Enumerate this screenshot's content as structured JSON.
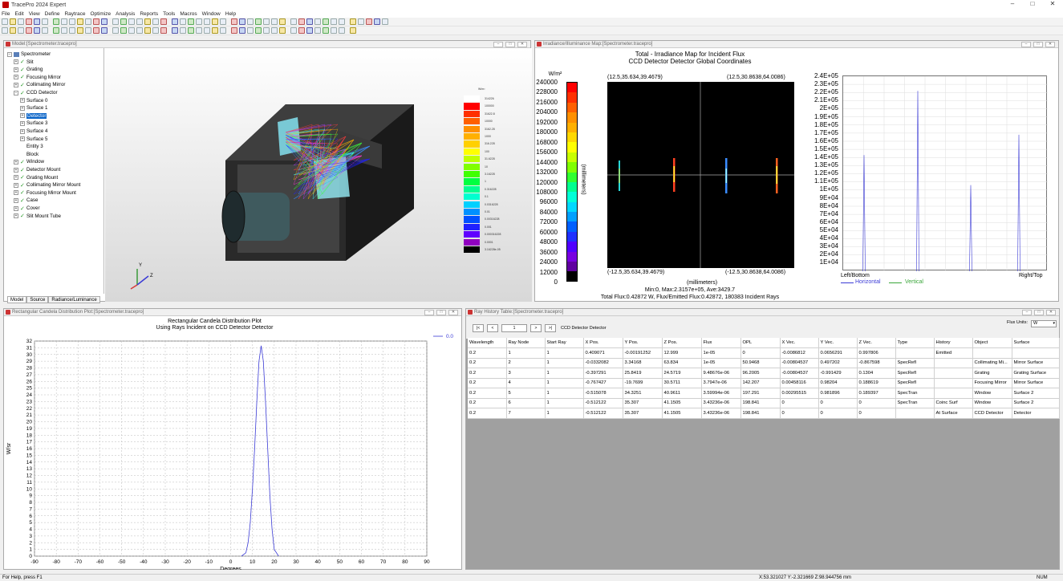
{
  "app": {
    "title": "TracePro 2024 Expert",
    "min": "–",
    "max": "□",
    "close": "✕"
  },
  "menu": [
    "File",
    "Edit",
    "View",
    "Define",
    "Raytrace",
    "Optimize",
    "Analysis",
    "Reports",
    "Tools",
    "Macros",
    "Window",
    "Help"
  ],
  "model": {
    "title": "Model:[Spectrometer.tracepro]",
    "tree": [
      {
        "label": "Spectrometer",
        "indent": 0,
        "exp": "−",
        "check": false,
        "root": true
      },
      {
        "label": "Slit",
        "indent": 1,
        "exp": "+",
        "check": true
      },
      {
        "label": "Grating",
        "indent": 1,
        "exp": "+",
        "check": true
      },
      {
        "label": "Focusing Mirror",
        "indent": 1,
        "exp": "+",
        "check": true
      },
      {
        "label": "Collimating Mirror",
        "indent": 1,
        "exp": "+",
        "check": true
      },
      {
        "label": "CCD Detector",
        "indent": 1,
        "exp": "−",
        "check": true
      },
      {
        "label": "Surface 0",
        "indent": 2,
        "exp": "+",
        "check": false
      },
      {
        "label": "Surface 1",
        "indent": 2,
        "exp": "+",
        "check": false
      },
      {
        "label": "Detector",
        "indent": 2,
        "exp": "+",
        "check": false,
        "selected": true
      },
      {
        "label": "Surface 3",
        "indent": 2,
        "exp": "+",
        "check": false
      },
      {
        "label": "Surface 4",
        "indent": 2,
        "exp": "+",
        "check": false
      },
      {
        "label": "Surface 5",
        "indent": 2,
        "exp": "+",
        "check": false
      },
      {
        "label": "Entity 3",
        "indent": 2,
        "exp": "",
        "check": false
      },
      {
        "label": "Block",
        "indent": 2,
        "exp": "",
        "check": false
      },
      {
        "label": "Window",
        "indent": 1,
        "exp": "+",
        "check": true
      },
      {
        "label": "Detector Mount",
        "indent": 1,
        "exp": "+",
        "check": true
      },
      {
        "label": "Grating Mount",
        "indent": 1,
        "exp": "+",
        "check": true
      },
      {
        "label": "Collimating Mirror Mount",
        "indent": 1,
        "exp": "+",
        "check": true
      },
      {
        "label": "Focusing Mirror Mount",
        "indent": 1,
        "exp": "+",
        "check": true
      },
      {
        "label": "Case",
        "indent": 1,
        "exp": "+",
        "check": true
      },
      {
        "label": "Cover",
        "indent": 1,
        "exp": "+",
        "check": true
      },
      {
        "label": "Slit Mount Tube",
        "indent": 1,
        "exp": "+",
        "check": true
      }
    ],
    "tabs": [
      "Model",
      "Source",
      "Radiance/Luminance"
    ],
    "legend_unit": "W/m²",
    "legend_labels": [
      "314226",
      "100000",
      "31622.8",
      "10000",
      "3162.28",
      "1000",
      "316.228",
      "100",
      "31.6228",
      "10",
      "3.16228",
      "1",
      "0.316228",
      "0.1",
      "0.0316228",
      "0.01",
      "0.00316228",
      "0.001",
      "0.000316228",
      "0.0001",
      "3.16228e-05"
    ],
    "axis_labels": {
      "y": "Y",
      "z": "Z"
    }
  },
  "irradiance": {
    "title": "Irradiance/Illuminance Map:[Spectrometer.tracepro]",
    "heading1": "Total - Irradiance Map for Incident Flux",
    "heading2": "CCD Detector Detector    Global Coordinates",
    "unit": "W/m²",
    "colorbar_ticks": [
      "240000",
      "228000",
      "216000",
      "204000",
      "192000",
      "180000",
      "168000",
      "156000",
      "144000",
      "132000",
      "120000",
      "108000",
      "96000",
      "84000",
      "72000",
      "60000",
      "48000",
      "36000",
      "24000",
      "12000",
      "0"
    ],
    "axis_label": "(millimeters)",
    "corner_tl": "(12.5,35.634,39.4679)",
    "corner_tr": "(12.5,30.8638,64.0086)",
    "corner_bl": "(-12.5,35.634,39.4679)",
    "corner_br": "(-12.5,30.8638,64.0086)",
    "stats1": "Min:0, Max:2.3157e+05, Ave:3429.7",
    "stats2": "Total Flux:0.42872 W, Flux/Emitted Flux:0.42872, 180383 Incident Rays",
    "profile_ticks": [
      "2.4E+05",
      "2.3E+05",
      "2.2E+05",
      "2.1E+05",
      "2E+05",
      "1.9E+05",
      "1.8E+05",
      "1.7E+05",
      "1.6E+05",
      "1.5E+05",
      "1.4E+05",
      "1.3E+05",
      "1.2E+05",
      "1.1E+05",
      "1E+05",
      "9E+04",
      "8E+04",
      "7E+04",
      "6E+04",
      "5E+04",
      "4E+04",
      "3E+04",
      "2E+04",
      "1E+04"
    ],
    "left_label": "Left/Bottom",
    "right_label": "Right/Top",
    "legend_h": "Horizontal",
    "legend_v": "Vertical",
    "color_h": "#3b3bd6",
    "color_v": "#3aa63a"
  },
  "candela": {
    "title": "Rectangular Candela Distribution Plot:[Spectrometer.tracepro]",
    "line_color": "#3b3bd6"
  },
  "chart_data": {
    "type": "line",
    "title": "Rectangular Candela Distribution Plot\nUsing Rays Incident on CCD Detector Detector",
    "xlabel": "Degrees",
    "ylabel": "W/sr",
    "xlim": [
      -90,
      90
    ],
    "ylim": [
      0,
      32
    ],
    "xticks": [
      -90,
      -80,
      -70,
      -60,
      -50,
      -40,
      -30,
      -20,
      -10,
      0,
      10,
      20,
      30,
      40,
      50,
      60,
      70,
      80,
      90
    ],
    "yticks": [
      0,
      1,
      2,
      3,
      4,
      5,
      6,
      7,
      8,
      9,
      10,
      11,
      12,
      13,
      14,
      15,
      16,
      17,
      18,
      19,
      20,
      21,
      22,
      23,
      24,
      25,
      26,
      27,
      28,
      29,
      30,
      31,
      32
    ],
    "grid": true,
    "legend": "top-right",
    "series": [
      {
        "name": "0.0",
        "x": [
          5,
          7,
          8,
          9,
          10,
          11,
          12,
          13,
          14,
          15,
          16,
          17,
          18,
          19,
          20,
          22
        ],
        "y": [
          0,
          0.5,
          2,
          5,
          10,
          16,
          23,
          29,
          31.3,
          29,
          23,
          16,
          9,
          4,
          1,
          0
        ]
      }
    ]
  },
  "rayhistory": {
    "title": "Ray History Table:[Spectrometer.tracepro]",
    "nav": {
      "first": "|<",
      "prev": "<",
      "page": "1",
      "next": ">",
      "last": ">|"
    },
    "surface_name": "CCD Detector Detector",
    "flux_units_label": "Flux Units:",
    "flux_units_value": "W",
    "columns": [
      "Wavelength",
      "Ray Node",
      "Start Ray",
      "X Pos.",
      "Y Pos.",
      "Z Pos.",
      "Flux",
      "OPL",
      "X Vec.",
      "Y Vec.",
      "Z Vec.",
      "Type",
      "History",
      "Object",
      "Surface"
    ],
    "rows": [
      [
        "0.2",
        "1",
        "1",
        "0.409071",
        "-0.00191252",
        "12.999",
        "1e-05",
        "0",
        "-0.0086812",
        "0.0656291",
        "0.997806",
        "",
        "Emitted",
        "",
        ""
      ],
      [
        "0.2",
        "2",
        "1",
        "-0.0332082",
        "3.34168",
        "63.834",
        "1e-05",
        "50.9468",
        "-0.00804537",
        "0.497202",
        "-0.867598",
        "SpecRefl",
        "",
        "Collimating Mi...",
        "Mirror Surface"
      ],
      [
        "0.2",
        "3",
        "1",
        "-0.397291",
        "25.8419",
        "24.5719",
        "9.48676e-06",
        "96.2005",
        "-0.00804537",
        "-0.991429",
        "0.1304",
        "SpecRefl",
        "",
        "Grating",
        "Grating Surface"
      ],
      [
        "0.2",
        "4",
        "1",
        "-0.767427",
        "-19.7699",
        "30.5711",
        "3.7947e-06",
        "142.207",
        "0.00458116",
        "0.98204",
        "0.188619",
        "SpecRefl",
        "",
        "Focusing Mirror",
        "Mirror Surface"
      ],
      [
        "0.2",
        "5",
        "1",
        "-0.515078",
        "34.3251",
        "40.9611",
        "3.59994e-06",
        "197.291",
        "0.00295515",
        "0.981896",
        "0.189397",
        "SpecTran",
        "",
        "Window",
        "Surface 2"
      ],
      [
        "0.2",
        "6",
        "1",
        "-0.512122",
        "35.307",
        "41.1505",
        "3.43236e-06",
        "198.841",
        "0",
        "0",
        "0",
        "SpecTran",
        "Coinc Surf",
        "Window",
        "Surface 2"
      ],
      [
        "0.2",
        "7",
        "1",
        "-0.512122",
        "35.307",
        "41.1505",
        "3.43236e-06",
        "198.841",
        "0",
        "0",
        "0",
        "",
        "At Surface",
        "CCD Detector",
        "Detector"
      ]
    ]
  },
  "status": {
    "help": "For Help, press F1",
    "coords": "X:53.321027 Y:-2.321669 Z:98.944756 mm",
    "num": "NUM"
  }
}
